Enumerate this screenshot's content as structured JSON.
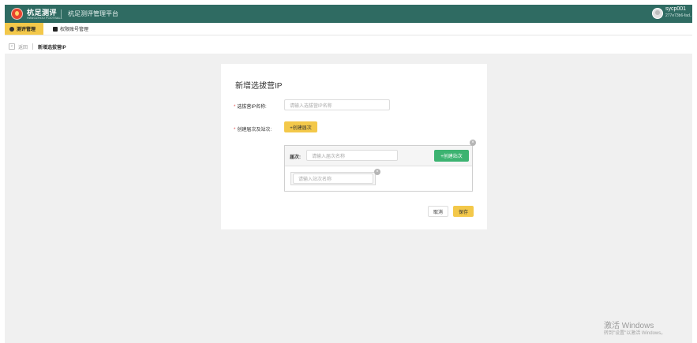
{
  "topbar": {
    "brand": "杭足测评",
    "brand_sub": "HANGZHOU FOOTBALL",
    "platform": "杭足测评管理平台",
    "user_name": "sycp001",
    "user_id": "277e73b6-fad..."
  },
  "menu": {
    "items": [
      {
        "label": "测评管理",
        "icon": "gear-icon"
      },
      {
        "label": "权限账号管理",
        "icon": "square-icon"
      }
    ]
  },
  "breadcrumb": {
    "back": "返回",
    "title": "新增选拔营IP"
  },
  "form": {
    "title": "新增选拔营IP",
    "ip_label": "选拔营IP名称:",
    "ip_placeholder": "请输入选拔营IP名称",
    "create_label": "创建届次及站次:",
    "create_round_button": "+创建届次",
    "round_label": "届次:",
    "round_placeholder": "请输入届次名称",
    "create_station_button": "+创建站次",
    "station_placeholder": "请输入站次名称",
    "cancel": "取消",
    "save": "保存"
  },
  "watermark": {
    "title": "激活 Windows",
    "sub": "转到\"设置\"以激活 Windows。"
  },
  "colors": {
    "header": "#2f6b62",
    "accent": "#f3c84a",
    "green_button": "#3cb371",
    "required": "#e23b3b"
  }
}
